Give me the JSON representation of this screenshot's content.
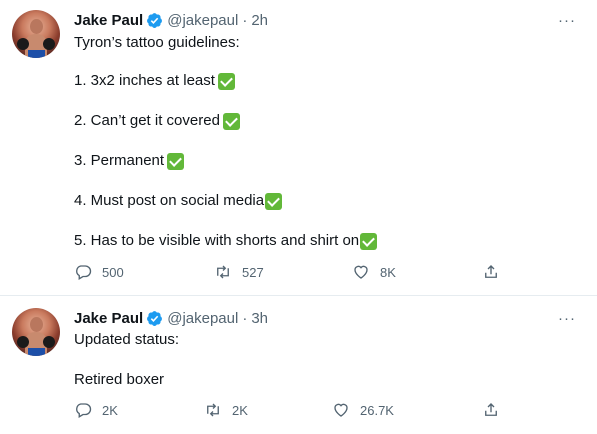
{
  "tweets": [
    {
      "author": {
        "name": "Jake Paul",
        "handle": "@jakepaul",
        "dot": "·",
        "time": "2h"
      },
      "lines": [
        "Tyron’s tattoo guidelines:",
        "1. 3x2 inches at least",
        "2. Can’t get it covered",
        "3. Permanent",
        "4. Must post on social media",
        "5. Has to be visible with shorts and shirt on"
      ],
      "stats": {
        "replies": "500",
        "retweets": "527",
        "likes": "8K"
      }
    },
    {
      "author": {
        "name": "Jake Paul",
        "handle": "@jakepaul",
        "dot": "·",
        "time": "3h"
      },
      "lines": [
        "Updated status:",
        "Retired boxer"
      ],
      "stats": {
        "replies": "2K",
        "retweets": "2K",
        "likes": "26.7K"
      }
    }
  ],
  "more_glyph": "···",
  "colors": {
    "verified": "#1d9bf0",
    "checkmark": "#62b839",
    "secondary_text": "#536471"
  }
}
